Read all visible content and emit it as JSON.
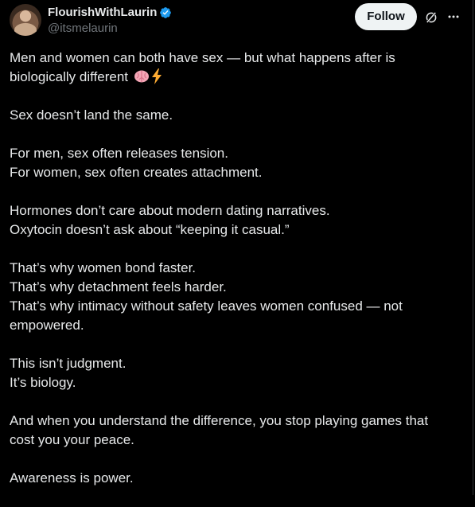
{
  "author": {
    "display_name": "FlourishWithLaurin",
    "handle": "@itsmelaurin",
    "verified": true,
    "avatar_icon": "profile-photo"
  },
  "actions": {
    "follow_label": "Follow",
    "grok_icon": "grok-icon",
    "more_icon": "more-icon"
  },
  "colors": {
    "background": "#000000",
    "text": "#e7e9ea",
    "secondary_text": "#71767b",
    "verified_badge": "#1d9bf0",
    "follow_button_bg": "#eff3f4"
  },
  "post": {
    "paragraphs": [
      {
        "lines": [
          "Men and women can both have sex — but what happens after is biologically different"
        ],
        "emojis": [
          "brain-emoji",
          "high-voltage-emoji"
        ]
      },
      {
        "lines": [
          "Sex doesn’t land the same."
        ]
      },
      {
        "lines": [
          "For men, sex often releases tension.",
          "For women, sex often creates attachment."
        ]
      },
      {
        "lines": [
          "Hormones don’t care about modern dating narratives.",
          "Oxytocin doesn’t ask about “keeping it casual.”"
        ]
      },
      {
        "lines": [
          "That’s why women bond faster.",
          "That’s why detachment feels harder.",
          "That’s why intimacy without safety leaves women confused — not empowered."
        ]
      },
      {
        "lines": [
          "This isn’t judgment.",
          "It’s biology."
        ]
      },
      {
        "lines": [
          "And when you understand the difference, you stop playing games that cost you your peace."
        ]
      },
      {
        "lines": [
          "Awareness is power."
        ]
      }
    ]
  }
}
